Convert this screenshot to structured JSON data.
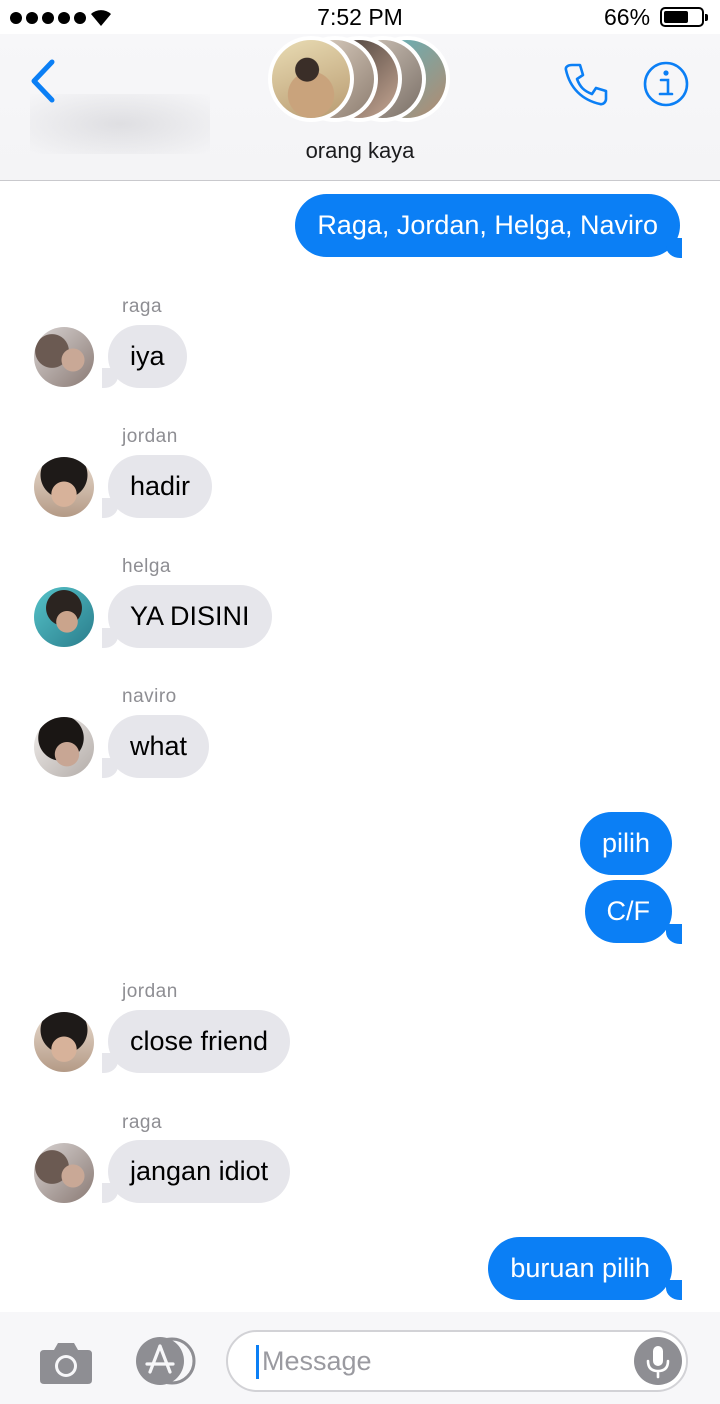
{
  "status_bar": {
    "time": "7:52 PM",
    "battery_percent": "66%",
    "battery_level": 0.66,
    "signal_bars": 5
  },
  "header": {
    "group_name": "orang kaya",
    "back_icon": "chevron-left-icon",
    "call_icon": "phone-icon",
    "info_icon": "info-icon"
  },
  "messages": [
    {
      "direction": "outgoing",
      "text": "Raga, Jordan, Helga, Naviro"
    },
    {
      "direction": "incoming",
      "sender": "raga",
      "text": "iya"
    },
    {
      "direction": "incoming",
      "sender": "jordan",
      "text": "hadir"
    },
    {
      "direction": "incoming",
      "sender": "helga",
      "text": "YA DISINI"
    },
    {
      "direction": "incoming",
      "sender": "naviro",
      "text": "what"
    },
    {
      "direction": "outgoing",
      "text": "pilih"
    },
    {
      "direction": "outgoing",
      "text": "C/F"
    },
    {
      "direction": "incoming",
      "sender": "jordan",
      "text": "close friend"
    },
    {
      "direction": "incoming",
      "sender": "raga",
      "text": "jangan idiot"
    },
    {
      "direction": "outgoing",
      "text": "buruan pilih"
    }
  ],
  "input_bar": {
    "placeholder": "Message",
    "camera_icon": "camera-icon",
    "apps_icon": "app-store-icon",
    "mic_icon": "microphone-icon"
  },
  "colors": {
    "accent": "#0b7ff5",
    "incoming_bubble": "#e6e6eb",
    "sender_label": "#8e8e93"
  }
}
